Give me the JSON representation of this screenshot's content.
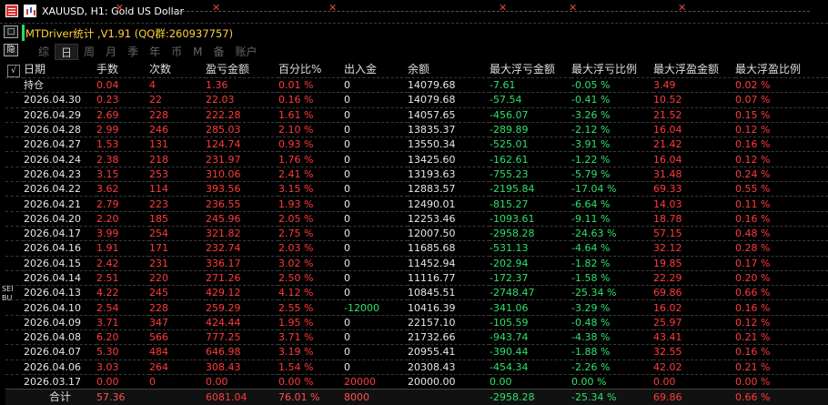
{
  "window": {
    "title": "XAUUSD, H1:  Gold US Dollar"
  },
  "panel": {
    "title": "MTDriver统计 ,V1.91 (QQ群:260937757)"
  },
  "left_toolbar": {
    "buttons": [
      "□",
      "隐"
    ],
    "side_labels": [
      "SEI",
      "BU"
    ]
  },
  "tabs": [
    {
      "label": "综",
      "active": false
    },
    {
      "label": "日",
      "active": true
    },
    {
      "label": "周",
      "active": false
    },
    {
      "label": "月",
      "active": false
    },
    {
      "label": "季",
      "active": false
    },
    {
      "label": "年",
      "active": false
    },
    {
      "label": "币",
      "active": false
    },
    {
      "label": "M",
      "active": false
    },
    {
      "label": "备",
      "active": false
    },
    {
      "label": "账户",
      "active": false
    }
  ],
  "table": {
    "check_glyph": "√",
    "headers": [
      "日期",
      "手数",
      "次数",
      "盈亏金额",
      "百分比%",
      "出入金",
      "余额",
      "最大浮亏金额",
      "最大浮亏比例",
      "最大浮盈金额",
      "最大浮盈比例"
    ],
    "rows": [
      [
        "持仓",
        "0.04",
        "4",
        "1.36",
        "0.01 %",
        "0",
        "14079.68",
        "-7.61",
        "-0.05 %",
        "3.49",
        "0.02 %"
      ],
      [
        "2026.04.30",
        "0.23",
        "22",
        "22.03",
        "0.16 %",
        "0",
        "14079.68",
        "-57.54",
        "-0.41 %",
        "10.52",
        "0.07 %"
      ],
      [
        "2026.04.29",
        "2.69",
        "228",
        "222.28",
        "1.61 %",
        "0",
        "14057.65",
        "-456.07",
        "-3.26 %",
        "21.52",
        "0.15 %"
      ],
      [
        "2026.04.28",
        "2.99",
        "246",
        "285.03",
        "2.10 %",
        "0",
        "13835.37",
        "-289.89",
        "-2.12 %",
        "16.04",
        "0.12 %"
      ],
      [
        "2026.04.27",
        "1.53",
        "131",
        "124.74",
        "0.93 %",
        "0",
        "13550.34",
        "-525.01",
        "-3.91 %",
        "21.42",
        "0.16 %"
      ],
      [
        "2026.04.24",
        "2.38",
        "218",
        "231.97",
        "1.76 %",
        "0",
        "13425.60",
        "-162.61",
        "-1.22 %",
        "16.04",
        "0.12 %"
      ],
      [
        "2026.04.23",
        "3.15",
        "253",
        "310.06",
        "2.41 %",
        "0",
        "13193.63",
        "-755.23",
        "-5.79 %",
        "31.48",
        "0.24 %"
      ],
      [
        "2026.04.22",
        "3.62",
        "114",
        "393.56",
        "3.15 %",
        "0",
        "12883.57",
        "-2195.84",
        "-17.04 %",
        "69.33",
        "0.55 %"
      ],
      [
        "2026.04.21",
        "2.79",
        "223",
        "236.55",
        "1.93 %",
        "0",
        "12490.01",
        "-815.27",
        "-6.64 %",
        "14.03",
        "0.11 %"
      ],
      [
        "2026.04.20",
        "2.20",
        "185",
        "245.96",
        "2.05 %",
        "0",
        "12253.46",
        "-1093.61",
        "-9.11 %",
        "18.78",
        "0.16 %"
      ],
      [
        "2026.04.17",
        "3.99",
        "254",
        "321.82",
        "2.75 %",
        "0",
        "12007.50",
        "-2958.28",
        "-24.63 %",
        "57.15",
        "0.48 %"
      ],
      [
        "2026.04.16",
        "1.91",
        "171",
        "232.74",
        "2.03 %",
        "0",
        "11685.68",
        "-531.13",
        "-4.64 %",
        "32.12",
        "0.28 %"
      ],
      [
        "2026.04.15",
        "2.42",
        "231",
        "336.17",
        "3.02 %",
        "0",
        "11452.94",
        "-202.94",
        "-1.82 %",
        "19.85",
        "0.17 %"
      ],
      [
        "2026.04.14",
        "2.51",
        "220",
        "271.26",
        "2.50 %",
        "0",
        "11116.77",
        "-172.37",
        "-1.58 %",
        "22.29",
        "0.20 %"
      ],
      [
        "2026.04.13",
        "4.22",
        "245",
        "429.12",
        "4.12 %",
        "0",
        "10845.51",
        "-2748.47",
        "-25.34 %",
        "69.86",
        "0.66 %"
      ],
      [
        "2026.04.10",
        "2.54",
        "228",
        "259.29",
        "2.55 %",
        "-12000",
        "10416.39",
        "-341.06",
        "-3.29 %",
        "16.02",
        "0.16 %"
      ],
      [
        "2026.04.09",
        "3.71",
        "347",
        "424.44",
        "1.95 %",
        "0",
        "22157.10",
        "-105.59",
        "-0.48 %",
        "25.97",
        "0.12 %"
      ],
      [
        "2026.04.08",
        "6.20",
        "566",
        "777.25",
        "3.71 %",
        "0",
        "21732.66",
        "-943.74",
        "-4.38 %",
        "43.41",
        "0.21 %"
      ],
      [
        "2026.04.07",
        "5.30",
        "484",
        "646.98",
        "3.19 %",
        "0",
        "20955.41",
        "-390.44",
        "-1.88 %",
        "32.55",
        "0.16 %"
      ],
      [
        "2026.04.06",
        "3.03",
        "264",
        "308.43",
        "1.54 %",
        "0",
        "20308.43",
        "-454.34",
        "-2.26 %",
        "42.02",
        "0.21 %"
      ],
      [
        "2026.03.17",
        "0.00",
        "0",
        "0.00",
        "0.00 %",
        "20000",
        "20000.00",
        "0.00",
        "0.00 %",
        "0.00",
        "0.00 %"
      ]
    ],
    "total": {
      "label": "合计",
      "values": [
        "57.36",
        "",
        "6081.04",
        "76.01 %",
        "8000",
        "",
        "-2958.28",
        "-25.34 %",
        "69.86",
        "0.66 %"
      ]
    }
  },
  "colors": {
    "profit": "#ff3b3b",
    "loss": "#2ee06a",
    "title": "#ffd23a",
    "background": "#000000"
  },
  "icons": [
    "grid-menu-icon",
    "chart-icon",
    "marker-icon",
    "checkbox-icon"
  ]
}
